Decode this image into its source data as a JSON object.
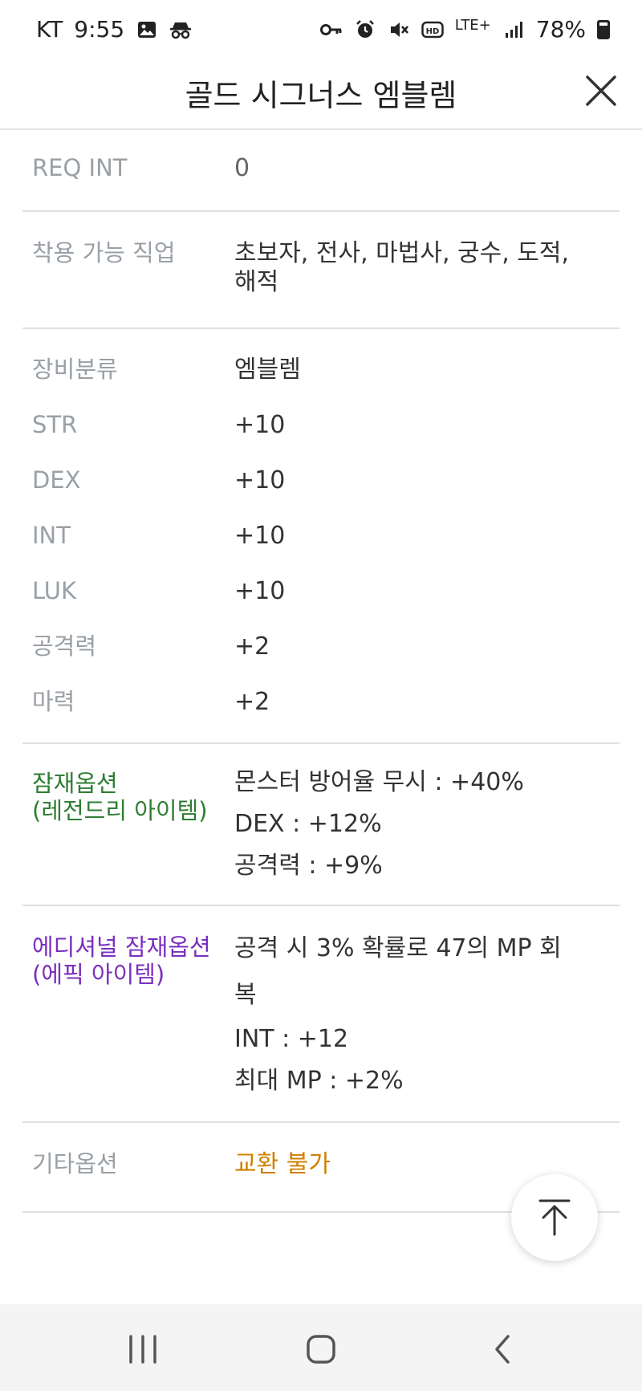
{
  "status_bar": {
    "carrier": "KT",
    "time": "9:55",
    "network": "LTE+",
    "battery": "78%"
  },
  "header": {
    "title": "골드 시그너스 엠블렘"
  },
  "item_details": {
    "req_int_label": "REQ INT",
    "req_int_value": "0",
    "jobs_label": "착용 가능 직업",
    "jobs_value_line1": "초보자, 전사, 마법사, 궁수, 도적,",
    "jobs_value_line2": "해적",
    "stats": [
      {
        "label": "장비분류",
        "value": "엠블렘"
      },
      {
        "label": "STR",
        "value": "+10"
      },
      {
        "label": "DEX",
        "value": "+10"
      },
      {
        "label": "INT",
        "value": "+10"
      },
      {
        "label": "LUK",
        "value": "+10"
      },
      {
        "label": "공격력",
        "value": "+2"
      },
      {
        "label": "마력",
        "value": "+2"
      }
    ],
    "potential": {
      "label_line1": "잠재옵션",
      "label_line2": "(레전드리 아이템)",
      "options": [
        "몬스터 방어율 무시 : +40%",
        "DEX : +12%",
        "공격력 : +9%"
      ],
      "color": "#2e7d32"
    },
    "additional_potential": {
      "label_line1": "에디셔널 잠재옵션",
      "label_line2": "(에픽 아이템)",
      "options": [
        "공격 시 3% 확률로 47의 MP 회",
        "복",
        "INT : +12",
        "최대 MP : +2%"
      ],
      "color": "#7b2fbf"
    },
    "other": {
      "label": "기타옵션",
      "value": "교환 불가",
      "color": "#d08000"
    }
  }
}
